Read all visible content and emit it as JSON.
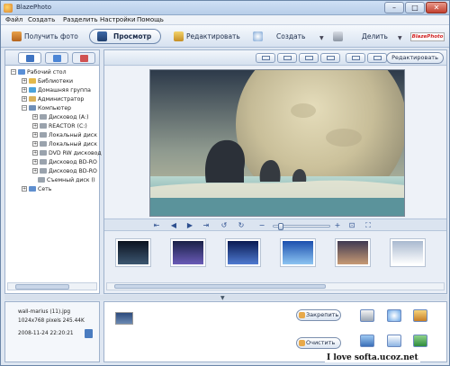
{
  "window": {
    "title": "BlazePhoto",
    "controls": {
      "minimize": "–",
      "maximize": "□",
      "close": "✕"
    }
  },
  "menu": [
    "Файл",
    "Создать",
    "Разделить",
    "Настройки",
    "Помощь"
  ],
  "toolbar": {
    "get_photo": "Получить фото",
    "view": "Просмотр",
    "edit": "Редактировать",
    "create": "Создать",
    "share": "Делить",
    "logo": "BlazePhoto"
  },
  "tree": [
    {
      "label": "Рабочий стол",
      "expander": "−",
      "icon_color": "#5a8fd6"
    },
    {
      "label": "Библиотеки",
      "expander": "+",
      "icon_color": "#e3b94b"
    },
    {
      "label": "Домашняя группа",
      "expander": "+",
      "icon_color": "#4aa3dc"
    },
    {
      "label": "Администратор",
      "expander": "+",
      "icon_color": "#d9b25c"
    },
    {
      "label": "Компьютер",
      "expander": "−",
      "icon_color": "#6f8fb8"
    },
    {
      "label": "Дисковод (A:)",
      "expander": "+",
      "icon_color": "#9aa3ad"
    },
    {
      "label": "REACTOR (C:)",
      "expander": "+",
      "icon_color": "#9aa3ad"
    },
    {
      "label": "Локальный диск",
      "expander": "+",
      "icon_color": "#9aa3ad"
    },
    {
      "label": "Локальный диск",
      "expander": "+",
      "icon_color": "#9aa3ad"
    },
    {
      "label": "DVD RW дисковод",
      "expander": "+",
      "icon_color": "#9aa3ad"
    },
    {
      "label": "Дисковод BD-RO",
      "expander": "+",
      "icon_color": "#9aa3ad"
    },
    {
      "label": "Дисковод BD-RO",
      "expander": "+",
      "icon_color": "#9aa3ad"
    },
    {
      "label": "Съемный диск (I",
      "expander": "",
      "icon_color": "#9aa3ad"
    },
    {
      "label": "Сеть",
      "expander": "+",
      "icon_color": "#5f8fcf"
    }
  ],
  "viewer": {
    "edit_button": "Редактировать",
    "nav_icons": [
      "first",
      "prev",
      "play",
      "next",
      "last",
      "rotate-left",
      "rotate-right",
      "zoom-out",
      "zoom-in",
      "fit",
      "fullscreen"
    ],
    "zoom_level": 0.09
  },
  "thumbnails": [
    {
      "name": "night-sky",
      "colors": [
        "#0c1320",
        "#3c5670"
      ]
    },
    {
      "name": "lightning",
      "colors": [
        "#1a2147",
        "#6a5bb7"
      ]
    },
    {
      "name": "city-night",
      "colors": [
        "#0a1a52",
        "#4f7ad0"
      ]
    },
    {
      "name": "blue-tree",
      "colors": [
        "#1c4fae",
        "#8cc4f2"
      ]
    },
    {
      "name": "dusk-shore",
      "colors": [
        "#403a52",
        "#c79a74"
      ]
    },
    {
      "name": "white-cloud",
      "colors": [
        "#a9b9cf",
        "#ffffff"
      ]
    }
  ],
  "info": {
    "filename": "wall-marius (11).jpg",
    "dimensions": "1024x768 pixels  245.44K",
    "date": "2008-11-24 22:20:21"
  },
  "tray": {
    "save_button": "Закрепить",
    "clear_button": "Очистить",
    "actions": [
      "print",
      "cd-burn",
      "save-as",
      "slideshow",
      "email",
      "export"
    ]
  },
  "watermark": "I love softa.ucoz.net"
}
